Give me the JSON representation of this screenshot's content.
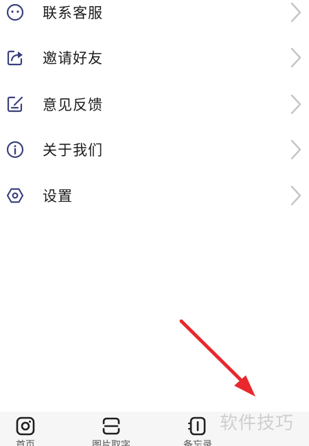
{
  "menu": {
    "items": [
      {
        "label": "联系客服",
        "icon": "customer-service-icon"
      },
      {
        "label": "邀请好友",
        "icon": "share-icon"
      },
      {
        "label": "意见反馈",
        "icon": "feedback-icon"
      },
      {
        "label": "关于我们",
        "icon": "info-icon"
      },
      {
        "label": "设置",
        "icon": "settings-icon"
      }
    ]
  },
  "tabbar": {
    "tabs": [
      {
        "label": "首页",
        "icon": "home-icon"
      },
      {
        "label": "图片取字",
        "icon": "scan-icon"
      },
      {
        "label": "备忘录",
        "icon": "notebook-icon"
      }
    ]
  },
  "watermark": "软件技巧",
  "colors": {
    "accent": "#3a3f7d",
    "chevron": "#c4c4c4",
    "annotation_arrow": "#e8282d",
    "tabbar_background": "#f6f6f6"
  }
}
